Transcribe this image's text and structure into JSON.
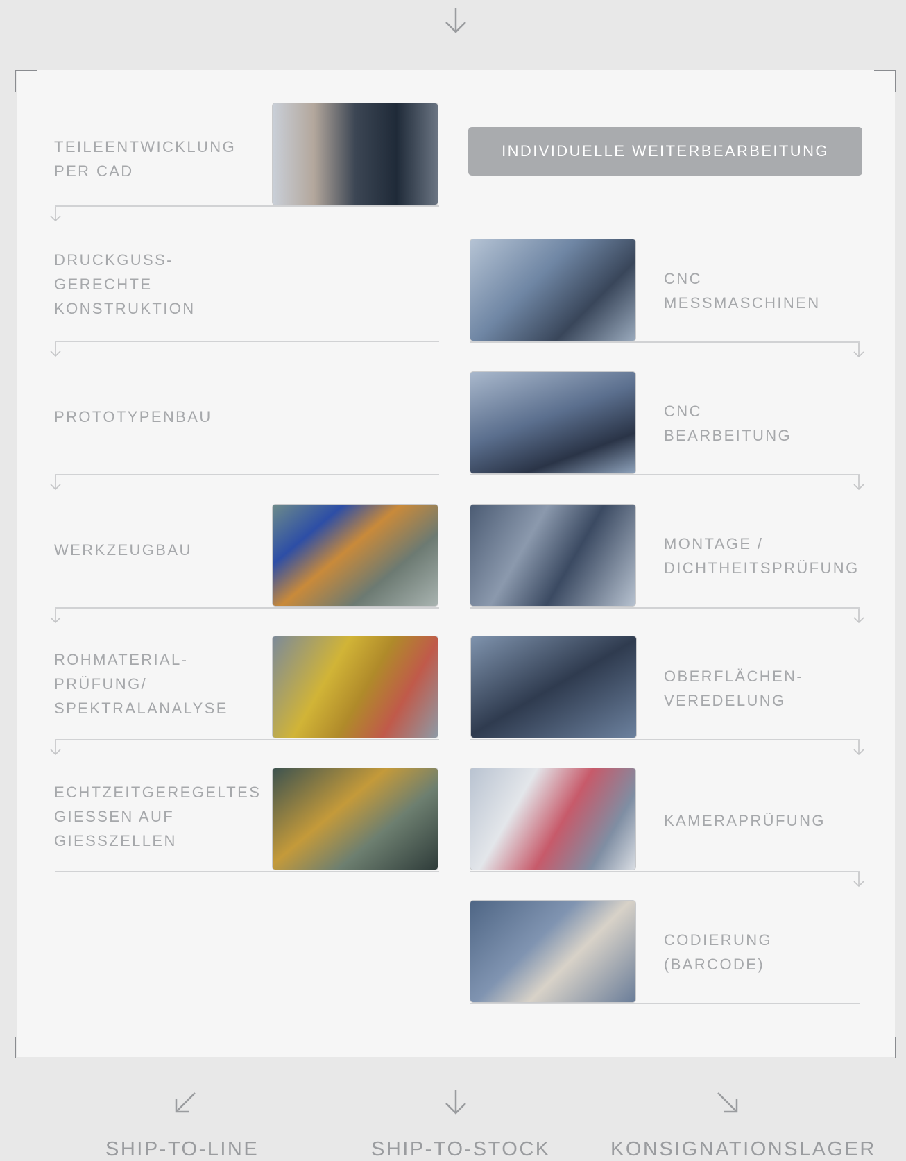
{
  "header": {
    "label": "INDIVIDUELLE WEITERBEARBEITUNG"
  },
  "left_steps": [
    {
      "label": "TEILEENTWICKLUNG\nPER CAD",
      "photo": "cad-workstation-photo"
    },
    {
      "label": "DRUCKGUSS-\nGERECHTE\nKONSTRUKTION"
    },
    {
      "label": "PROTOTYPENBAU"
    },
    {
      "label": "WERKZEUGBAU",
      "photo": "tooling-photo"
    },
    {
      "label": "ROHMATERIAL-\nPRÜFUNG/\nSPEKTRALANALYSE",
      "photo": "raw-material-photo"
    },
    {
      "label": "ECHTZEITGEREGELTES\nGIESSEN AUF\nGIESSZELLEN",
      "photo": "casting-cell-photo"
    }
  ],
  "right_steps": [
    {
      "label": "CNC\nMESSMASCHINEN",
      "photo": "cnc-measuring-photo"
    },
    {
      "label": "CNC\nBEARBEITUNG",
      "photo": "cnc-machining-photo"
    },
    {
      "label": "MONTAGE /\nDICHTHEITSPRÜFUNG",
      "photo": "assembly-photo"
    },
    {
      "label": "OBERFLÄCHEN-\nVEREDELUNG",
      "photo": "surface-finishing-photo"
    },
    {
      "label": "KAMERAPRÜFUNG",
      "photo": "camera-inspection-photo"
    },
    {
      "label": "CODIERUNG\n(BARCODE)",
      "photo": "barcode-coding-photo"
    }
  ],
  "outputs": [
    {
      "label": "SHIP-TO-LINE",
      "icon": "arrow-down-left-icon"
    },
    {
      "label": "SHIP-TO-STOCK",
      "icon": "arrow-down-icon"
    },
    {
      "label": "KONSIGNATIONSLAGER",
      "icon": "arrow-down-right-icon"
    }
  ],
  "colors": {
    "background": "#e8e8e8",
    "panel": "#f6f6f6",
    "text": "#a6a8ab",
    "header_fill": "#a9abae",
    "line": "#d1d2d4"
  }
}
